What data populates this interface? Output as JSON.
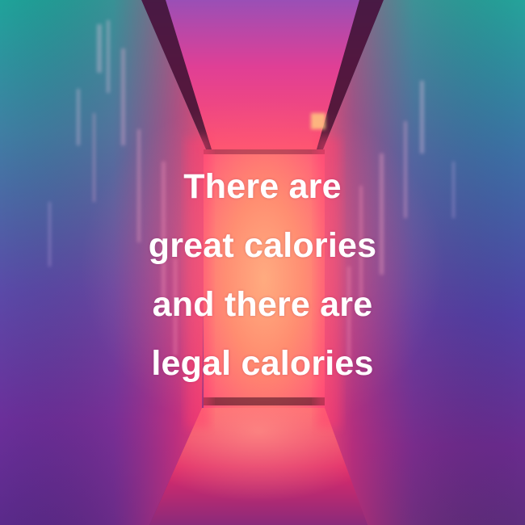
{
  "quote": {
    "lines": [
      "There are",
      "great calories",
      "and there are",
      "legal calories"
    ]
  }
}
